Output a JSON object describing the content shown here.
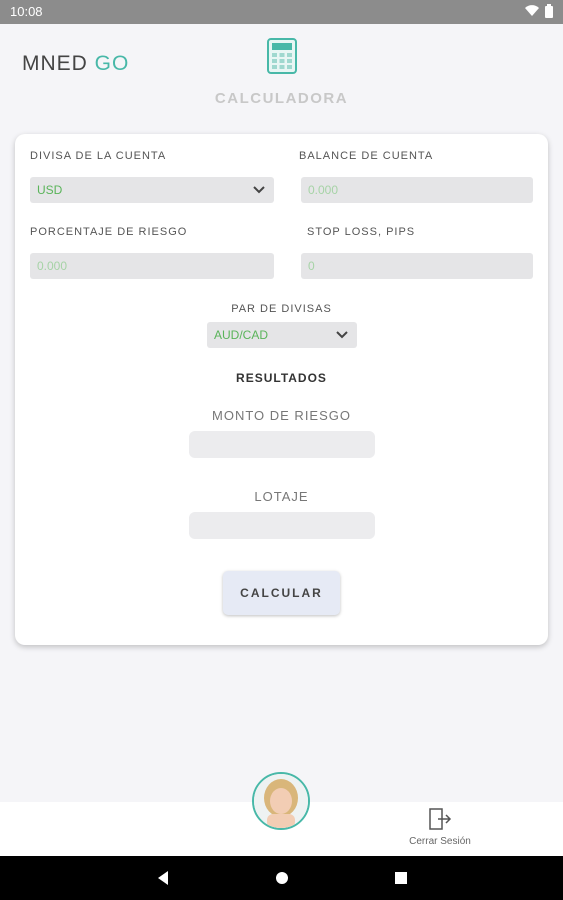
{
  "status_bar": {
    "time": "10:08"
  },
  "header": {
    "logo_main": "MNED ",
    "logo_accent": "GO",
    "title": "CALCULADORA"
  },
  "form": {
    "account_currency": {
      "label": "DIVISA DE LA CUENTA",
      "value": "USD"
    },
    "account_balance": {
      "label": "BALANCE DE CUENTA",
      "placeholder": "0.000"
    },
    "risk_percentage": {
      "label": "PORCENTAJE DE RIESGO",
      "placeholder": "0.000"
    },
    "stop_loss": {
      "label": "STOP LOSS, PIPS",
      "placeholder": "0"
    },
    "currency_pair": {
      "label": "PAR DE DIVISAS",
      "value": "AUD/CAD"
    }
  },
  "results": {
    "title": "RESULTADOS",
    "risk_amount": {
      "label": "MONTO DE RIESGO",
      "value": ""
    },
    "lot_size": {
      "label": "LOTAJE",
      "value": ""
    }
  },
  "calculate_button": {
    "label": "CALCULAR"
  },
  "bottom_nav": {
    "logout_label": "Cerrar Sesión"
  },
  "colors": {
    "accent": "#48b8a8",
    "field_text": "#5ab45a"
  }
}
